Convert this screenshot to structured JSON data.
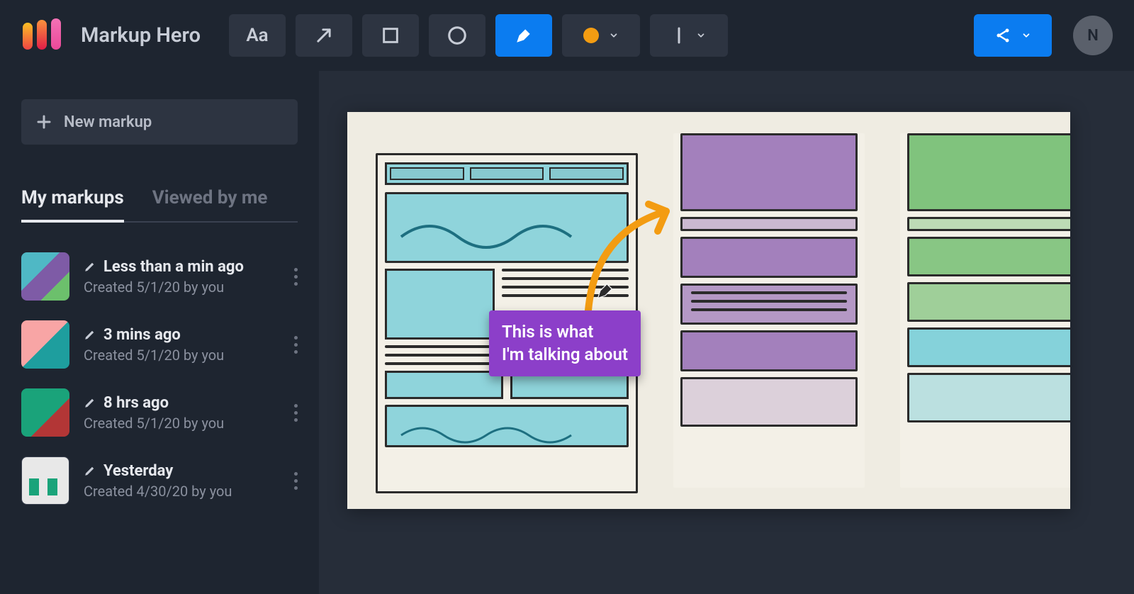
{
  "app_title": "Markup Hero",
  "toolbar": {
    "text_label": "Aa",
    "color_swatch": "#f39c12"
  },
  "share_label": "Share",
  "avatar_initial": "N",
  "sidebar": {
    "new_markup_label": "New markup",
    "tabs": {
      "mine": "My markups",
      "viewed": "Viewed by me",
      "active": "mine"
    },
    "items": [
      {
        "title": "Less than a min ago",
        "meta": "Created 5/1/20 by you"
      },
      {
        "title": "3 mins ago",
        "meta": "Created 5/1/20 by you"
      },
      {
        "title": "8 hrs ago",
        "meta": "Created 5/1/20 by you"
      },
      {
        "title": "Yesterday",
        "meta": "Created 4/30/20 by you"
      }
    ]
  },
  "canvas": {
    "annotation_line1": "This is what",
    "annotation_line2": "I'm talking about",
    "annotation_color": "#8c3fc9",
    "arrow_color": "#f39c12"
  }
}
